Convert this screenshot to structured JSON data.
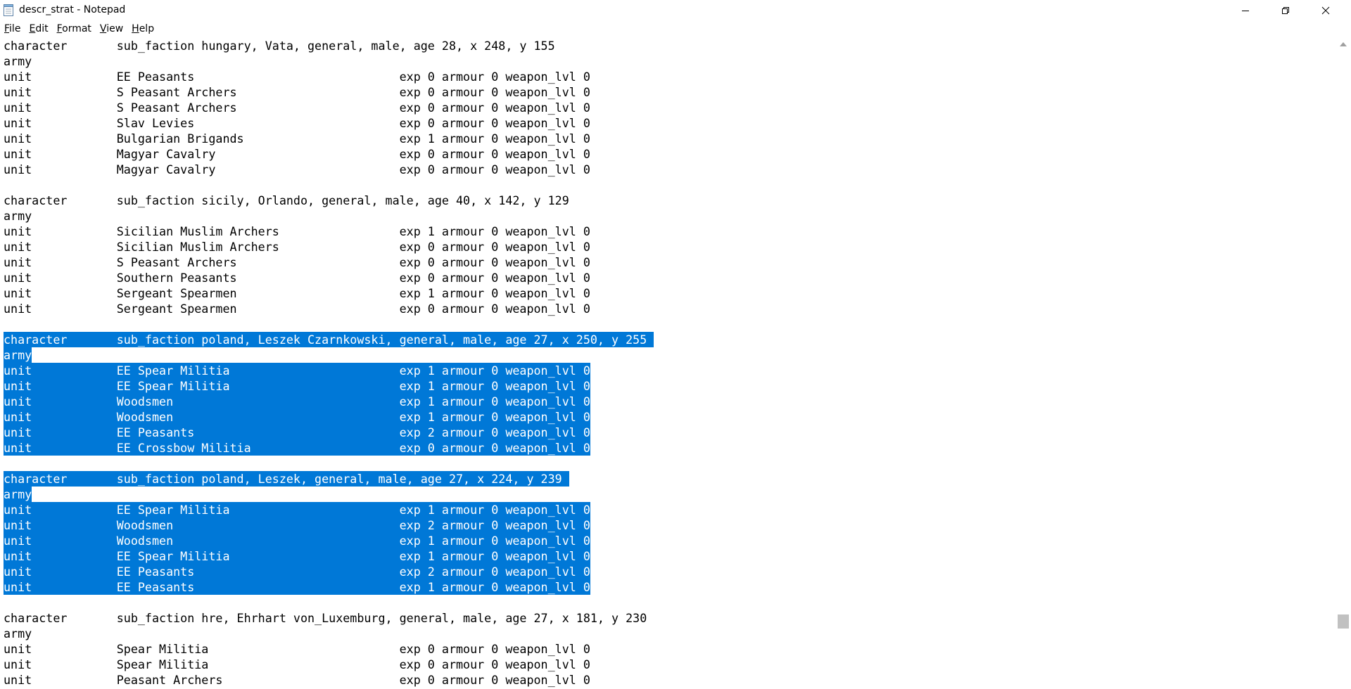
{
  "window": {
    "title": "descr_strat - Notepad"
  },
  "menu": {
    "items": [
      {
        "label": "File",
        "underline": "F",
        "rest": "ile"
      },
      {
        "label": "Edit",
        "underline": "E",
        "rest": "dit"
      },
      {
        "label": "Format",
        "underline": "F",
        "rest": "ormat"
      },
      {
        "label": "View",
        "underline": "V",
        "rest": "iew"
      },
      {
        "label": "Help",
        "underline": "H",
        "rest": "elp"
      }
    ]
  },
  "editor": {
    "lines": [
      {
        "text": "character       sub_faction hungary, Vata, general, male, age 28, x 248, y 155",
        "selected": false
      },
      {
        "text": "army",
        "selected": false
      },
      {
        "text": "unit            EE Peasants                             exp 0 armour 0 weapon_lvl 0",
        "selected": false
      },
      {
        "text": "unit            S Peasant Archers                       exp 0 armour 0 weapon_lvl 0",
        "selected": false
      },
      {
        "text": "unit            S Peasant Archers                       exp 0 armour 0 weapon_lvl 0",
        "selected": false
      },
      {
        "text": "unit            Slav Levies                             exp 0 armour 0 weapon_lvl 0",
        "selected": false
      },
      {
        "text": "unit            Bulgarian Brigands                      exp 1 armour 0 weapon_lvl 0",
        "selected": false
      },
      {
        "text": "unit            Magyar Cavalry                          exp 0 armour 0 weapon_lvl 0",
        "selected": false
      },
      {
        "text": "unit            Magyar Cavalry                          exp 0 armour 0 weapon_lvl 0",
        "selected": false
      },
      {
        "text": "",
        "selected": false
      },
      {
        "text": "character       sub_faction sicily, Orlando, general, male, age 40, x 142, y 129",
        "selected": false
      },
      {
        "text": "army",
        "selected": false
      },
      {
        "text": "unit            Sicilian Muslim Archers                 exp 1 armour 0 weapon_lvl 0",
        "selected": false
      },
      {
        "text": "unit            Sicilian Muslim Archers                 exp 0 armour 0 weapon_lvl 0",
        "selected": false
      },
      {
        "text": "unit            S Peasant Archers                       exp 0 armour 0 weapon_lvl 0",
        "selected": false
      },
      {
        "text": "unit            Southern Peasants                       exp 0 armour 0 weapon_lvl 0",
        "selected": false
      },
      {
        "text": "unit            Sergeant Spearmen                       exp 1 armour 0 weapon_lvl 0",
        "selected": false
      },
      {
        "text": "unit            Sergeant Spearmen                       exp 0 armour 0 weapon_lvl 0",
        "selected": false
      },
      {
        "text": "",
        "selected": false
      },
      {
        "text": "character       sub_faction poland, Leszek Czarnkowski, general, male, age 27, x 250, y 255 ",
        "selected": true
      },
      {
        "text": "army",
        "selected": true
      },
      {
        "text": "unit            EE Spear Militia                        exp 1 armour 0 weapon_lvl 0",
        "selected": true
      },
      {
        "text": "unit            EE Spear Militia                        exp 1 armour 0 weapon_lvl 0",
        "selected": true
      },
      {
        "text": "unit            Woodsmen                                exp 1 armour 0 weapon_lvl 0",
        "selected": true
      },
      {
        "text": "unit            Woodsmen                                exp 1 armour 0 weapon_lvl 0",
        "selected": true
      },
      {
        "text": "unit            EE Peasants                             exp 2 armour 0 weapon_lvl 0",
        "selected": true
      },
      {
        "text": "unit            EE Crossbow Militia                     exp 0 armour 0 weapon_lvl 0",
        "selected": true
      },
      {
        "text": "",
        "selected": false
      },
      {
        "text": "character       sub_faction poland, Leszek, general, male, age 27, x 224, y 239 ",
        "selected": true
      },
      {
        "text": "army",
        "selected": true
      },
      {
        "text": "unit            EE Spear Militia                        exp 1 armour 0 weapon_lvl 0",
        "selected": true
      },
      {
        "text": "unit            Woodsmen                                exp 2 armour 0 weapon_lvl 0",
        "selected": true
      },
      {
        "text": "unit            Woodsmen                                exp 1 armour 0 weapon_lvl 0",
        "selected": true
      },
      {
        "text": "unit            EE Spear Militia                        exp 1 armour 0 weapon_lvl 0",
        "selected": true
      },
      {
        "text": "unit            EE Peasants                             exp 2 armour 0 weapon_lvl 0",
        "selected": true
      },
      {
        "text": "unit            EE Peasants                             exp 1 armour 0 weapon_lvl 0",
        "selected": true
      },
      {
        "text": "",
        "selected": false
      },
      {
        "text": "character       sub_faction hre, Ehrhart von_Luxemburg, general, male, age 27, x 181, y 230",
        "selected": false
      },
      {
        "text": "army",
        "selected": false
      },
      {
        "text": "unit            Spear Militia                           exp 0 armour 0 weapon_lvl 0",
        "selected": false
      },
      {
        "text": "unit            Spear Militia                           exp 0 armour 0 weapon_lvl 0",
        "selected": false
      },
      {
        "text": "unit            Peasant Archers                         exp 0 armour 0 weapon_lvl 0",
        "selected": false
      }
    ]
  },
  "colors": {
    "selection": "#0078d7",
    "selection_text": "#ffffff",
    "scroll_thumb": "#c1c1c1"
  },
  "icons": {
    "app": "notepad-icon",
    "minimize": "minimize-icon",
    "maximize": "restore-icon",
    "close": "close-icon",
    "scroll_up": "scroll-up-arrow-icon"
  }
}
